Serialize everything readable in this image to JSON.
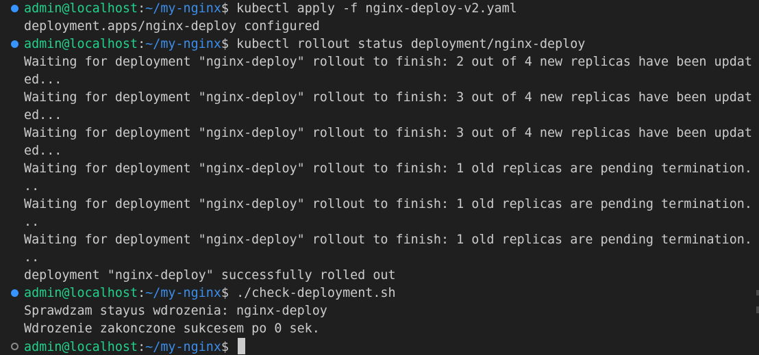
{
  "terminal": {
    "lines": [
      {
        "kind": "prompt",
        "status": "done",
        "user": "admin@localhost",
        "sep": ":",
        "path": "~/my-nginx",
        "sym": "$ ",
        "cmd": "kubectl apply -f nginx-deploy-v2.yaml"
      },
      {
        "kind": "output",
        "text": "deployment.apps/nginx-deploy configured"
      },
      {
        "kind": "prompt",
        "status": "done",
        "user": "admin@localhost",
        "sep": ":",
        "path": "~/my-nginx",
        "sym": "$ ",
        "cmd": "kubectl rollout status deployment/nginx-deploy"
      },
      {
        "kind": "output",
        "text": "Waiting for deployment \"nginx-deploy\" rollout to finish: 2 out of 4 new replicas have been updat"
      },
      {
        "kind": "output",
        "text": "ed..."
      },
      {
        "kind": "output",
        "text": "Waiting for deployment \"nginx-deploy\" rollout to finish: 3 out of 4 new replicas have been updat"
      },
      {
        "kind": "output",
        "text": "ed..."
      },
      {
        "kind": "output",
        "text": "Waiting for deployment \"nginx-deploy\" rollout to finish: 3 out of 4 new replicas have been updat"
      },
      {
        "kind": "output",
        "text": "ed..."
      },
      {
        "kind": "output",
        "text": "Waiting for deployment \"nginx-deploy\" rollout to finish: 1 old replicas are pending termination."
      },
      {
        "kind": "output",
        "text": ".."
      },
      {
        "kind": "output",
        "text": "Waiting for deployment \"nginx-deploy\" rollout to finish: 1 old replicas are pending termination."
      },
      {
        "kind": "output",
        "text": ".."
      },
      {
        "kind": "output",
        "text": "Waiting for deployment \"nginx-deploy\" rollout to finish: 1 old replicas are pending termination."
      },
      {
        "kind": "output",
        "text": ".."
      },
      {
        "kind": "output",
        "text": "deployment \"nginx-deploy\" successfully rolled out"
      },
      {
        "kind": "prompt",
        "status": "done",
        "user": "admin@localhost",
        "sep": ":",
        "path": "~/my-nginx",
        "sym": "$ ",
        "cmd": "./check-deployment.sh"
      },
      {
        "kind": "output",
        "text": "Sprawdzam stayus wdrozenia: nginx-deploy"
      },
      {
        "kind": "output",
        "text": "Wdrozenie zakonczone sukcesem po 0 sek."
      },
      {
        "kind": "prompt",
        "status": "pending",
        "user": "admin@localhost",
        "sep": ":",
        "path": "~/my-nginx",
        "sym": "$ ",
        "cmd": "",
        "cursor": true
      }
    ]
  },
  "colors": {
    "background": "#1f1f1f",
    "prompt_user": "#23d18b",
    "prompt_path": "#3b8eea",
    "text": "#cccccc",
    "decoration_done": "#3794ff",
    "decoration_pending": "#8a8a8a"
  },
  "icons": {
    "done_marker": "command-success-dot-icon",
    "pending_marker": "command-pending-circle-icon"
  }
}
